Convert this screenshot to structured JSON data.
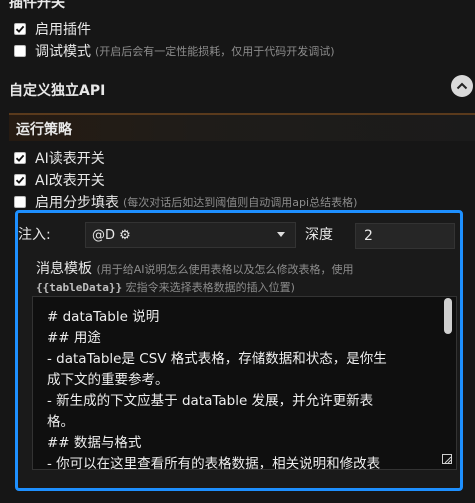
{
  "plugin_section": {
    "title": "插件开关",
    "enable_plugin": {
      "label": "启用插件",
      "checked": true
    },
    "debug_mode": {
      "label": "调试模式",
      "hint": "(开启后会有一定性能损耗，仅用于代码开发调试)",
      "checked": false
    }
  },
  "custom_api": {
    "title": "自定义独立API",
    "collapse_icon": "chevron-up-icon"
  },
  "strategy": {
    "title": "运行策略",
    "ai_read": {
      "label": "AI读表开关",
      "checked": true
    },
    "ai_edit": {
      "label": "AI改表开关",
      "checked": true
    },
    "step_fill": {
      "label": "启用分步填表",
      "hint": "(每次对话后如达到阈值则自动调用api总结表格)",
      "checked": false
    }
  },
  "injection": {
    "label": "注入:",
    "selected": "@D ⚙",
    "depth_label": "深度",
    "depth_value": "2"
  },
  "message_template": {
    "label": "消息模板",
    "hint_part1": "(用于给AI说明怎么使用表格以及怎么修改表格，使用",
    "hint_code": "{{tableData}}",
    "hint_part2": "宏指令来选择表格数据的插入位置)",
    "lines": [
      "# dataTable 说明",
      "  ## 用途",
      "  - dataTable是 CSV 格式表格，存储数据和状态，是你生",
      "成下文的重要参考。",
      "  - 新生成的下文应基于 dataTable 发展，并允许更新表",
      "格。",
      "  ## 数据与格式",
      "  - 你可以在这里查看所有的表格数据，相关说明和修改表"
    ]
  },
  "colors": {
    "accent": "#1e90ff",
    "background": "#161616"
  }
}
